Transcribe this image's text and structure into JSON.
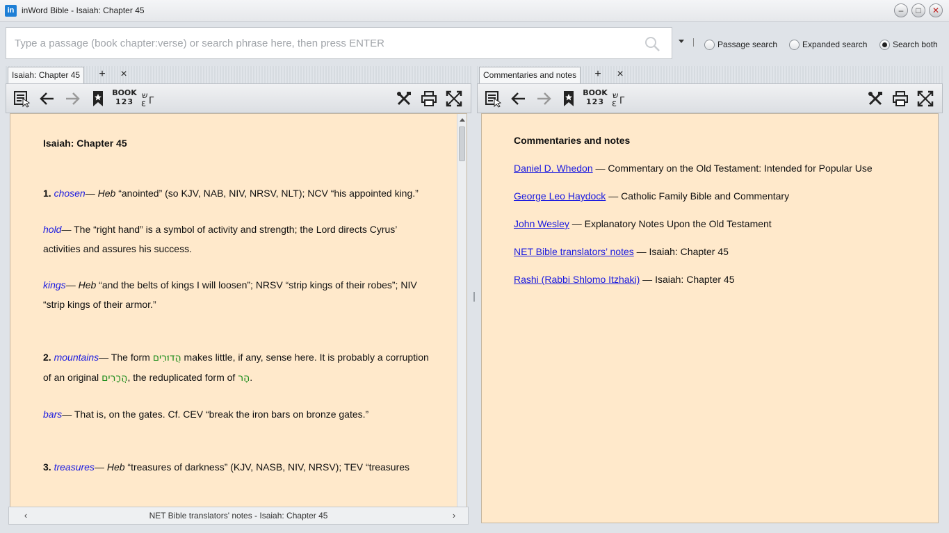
{
  "window": {
    "title": "inWord Bible - Isaiah: Chapter 45",
    "logo_text": "in",
    "minimize": "–",
    "maximize": "□",
    "close": "✕"
  },
  "search": {
    "placeholder": "Type a passage (book chapter:verse) or search phrase here, then press ENTER",
    "value": "",
    "options": [
      {
        "label": "Passage search",
        "checked": false
      },
      {
        "label": "Expanded search",
        "checked": false
      },
      {
        "label": "Search both",
        "checked": true
      }
    ]
  },
  "left_pane": {
    "tab_label": "Isaiah: Chapter 45",
    "add_tab": "+",
    "close_tab": "×",
    "book_label": "BOOK",
    "book_num": "123",
    "heading": "Isaiah: Chapter 45",
    "notes": {
      "n1_num": "1.",
      "n1_term": "chosen",
      "n1_dash": "— ",
      "n1_heb": "Heb",
      "n1_text": " “anointed” (so KJV, NAB, NIV, NRSV, NLT); NCV “his appointed king.”",
      "n2_term": "hold",
      "n2_text": "— The “right hand” is a symbol of activity and strength; the Lord directs Cyrus’ activities and assures his success.",
      "n3_term": "kings",
      "n3_dash": "— ",
      "n3_heb": "Heb",
      "n3_text": " “and the belts of kings I will loosen”; NRSV “strip kings of their robes”; NIV “strip kings of their armor.”",
      "n4_num": "2.",
      "n4_term": "mountains",
      "n4_text_a": "— The form ",
      "n4_hebrew_a": "הֲדוּרִים",
      "n4_text_b": " makes little, if any, sense here. It is probably a corruption of an original ",
      "n4_hebrew_b": "הֲרָרִים",
      "n4_text_c": ", the reduplicated form of ",
      "n4_hebrew_c": "הָר",
      "n4_text_d": ".",
      "n5_term": "bars",
      "n5_text": "— That is, on the gates. Cf. CEV “break the iron bars on bronze gates.”",
      "n6_num": "3.",
      "n6_term": "treasures",
      "n6_dash": "— ",
      "n6_heb": "Heb",
      "n6_text": " “treasures of darkness” (KJV, NASB, NIV, NRSV); TEV “treasures"
    },
    "status_text": "NET Bible translators' notes - Isaiah: Chapter 45",
    "status_prev": "‹",
    "status_next": "›"
  },
  "right_pane": {
    "tab_label": "Commentaries and notes",
    "add_tab": "+",
    "close_tab": "×",
    "book_label": "BOOK",
    "book_num": "123",
    "heading": "Commentaries and notes",
    "items": [
      {
        "link": "Daniel D. Whedon",
        "desc": " — Commentary on the Old Testament: Intended for Popular Use"
      },
      {
        "link": "George Leo Haydock",
        "desc": " — Catholic Family Bible and Commentary"
      },
      {
        "link": "John Wesley",
        "desc": " — Explanatory Notes Upon the Old Testament"
      },
      {
        "link": "NET Bible translators’ notes",
        "desc": " — Isaiah: Chapter 45"
      },
      {
        "link": "Rashi (Rabbi Shlomo Itzhaki)",
        "desc": " — Isaiah: Chapter 45"
      }
    ]
  },
  "colors": {
    "content_bg": "#ffe9cb",
    "link": "#1a1ae0",
    "hebrew": "#1a8c1a"
  }
}
